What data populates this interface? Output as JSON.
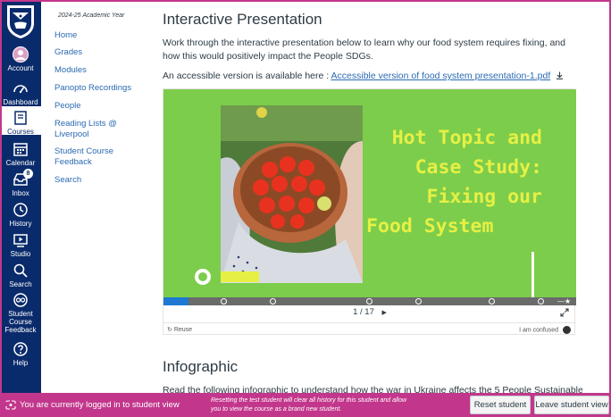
{
  "global_nav": {
    "items": [
      {
        "label": "Account",
        "icon": "avatar-icon"
      },
      {
        "label": "Dashboard",
        "icon": "dashboard-icon"
      },
      {
        "label": "Courses",
        "icon": "courses-icon"
      },
      {
        "label": "Calendar",
        "icon": "calendar-icon"
      },
      {
        "label": "Inbox",
        "icon": "inbox-icon",
        "badge": "8"
      },
      {
        "label": "History",
        "icon": "history-icon"
      },
      {
        "label": "Studio",
        "icon": "studio-icon"
      },
      {
        "label": "Search",
        "icon": "search-icon"
      },
      {
        "label": "Student Course Feedback",
        "icon": "feedback-icon"
      },
      {
        "label": "Help",
        "icon": "help-icon"
      }
    ],
    "active": "Courses",
    "background": "#0a2b6b"
  },
  "course_nav": {
    "year": "2024-25 Academic Year",
    "links": [
      "Home",
      "Grades",
      "Modules",
      "Panopto Recordings",
      "People",
      "Reading Lists @ Liverpool",
      "Student Course Feedback",
      "Search"
    ],
    "link_color": "#2b6ab3"
  },
  "content": {
    "heading": "Interactive Presentation",
    "intro": "Work through the interactive presentation below to learn why our food system requires fixing, and how this would positively impact the People SDGs.",
    "accessible_prefix": "An accessible version is available here : ",
    "accessible_link": "Accessible version of food system presentation-1.pdf",
    "presentation": {
      "slide_title_line1": "Hot Topic and",
      "slide_title_line2": "Case Study:",
      "slide_title_line3": "Fixing our",
      "slide_title_line4": "Food System",
      "slide_bg": "#7ccd4b",
      "title_color": "#e6f044",
      "page_current": "1",
      "page_total": "17",
      "page_sep": " / ",
      "reuse_label": "Reuse",
      "confused_label": "I am confused",
      "progress": 0.06
    },
    "heading2": "Infographic",
    "infographic_text": "Read the following infographic to understand how the war in Ukraine affects the 5 People Sustainable"
  },
  "student_view": {
    "message": "You are currently logged in to student view",
    "note": "Resetting the test student will clear all history for this student and allow you to view the course as a brand new student.",
    "reset_label": "Reset student",
    "leave_label": "Leave student view",
    "bar_color": "#c2378c"
  }
}
